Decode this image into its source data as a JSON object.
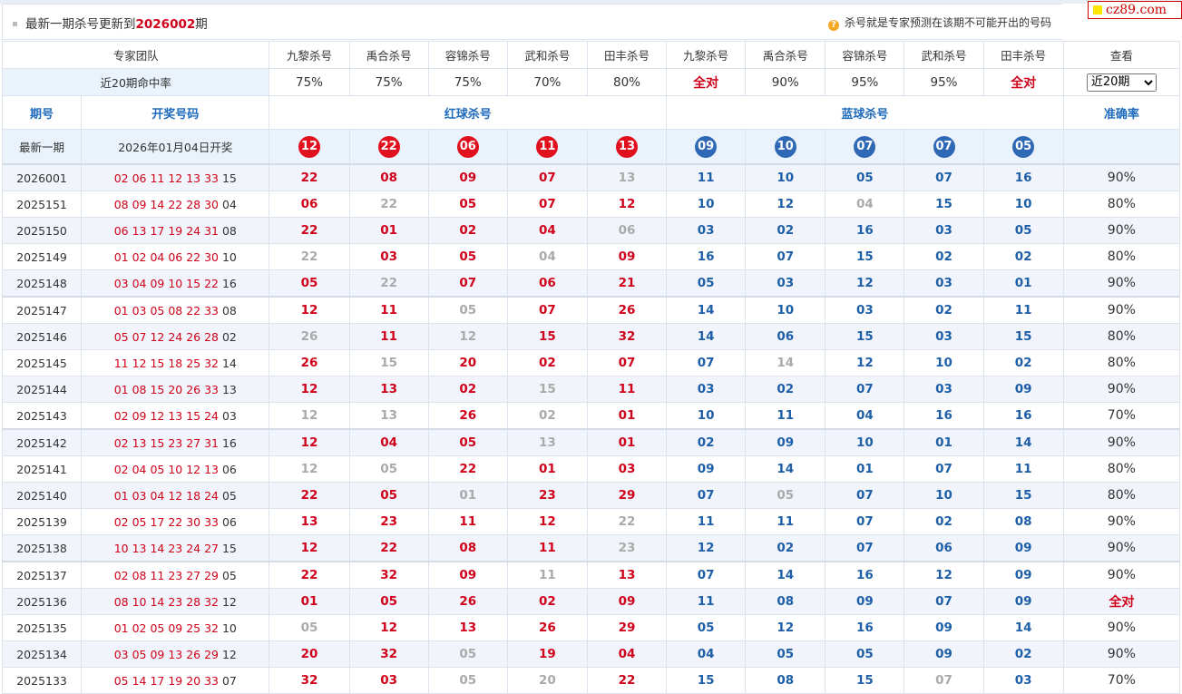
{
  "header": {
    "title_prefix": "最新一期杀号更新到",
    "title_period": "2026002",
    "title_suffix": "期",
    "tip": "杀号就是专家预测在该期不可能开出的号码",
    "logo": "cz89.com"
  },
  "table": {
    "team_label": "专家团队",
    "view_label": "查看",
    "experts": [
      "九黎杀号",
      "禹合杀号",
      "容锦杀号",
      "武和杀号",
      "田丰杀号",
      "九黎杀号",
      "禹合杀号",
      "容锦杀号",
      "武和杀号",
      "田丰杀号"
    ],
    "hit_label": "近20期命中率",
    "hit_rates": [
      "75%",
      "75%",
      "75%",
      "70%",
      "80%",
      "全对",
      "90%",
      "95%",
      "95%",
      "全对"
    ],
    "view_select": "近20期",
    "col_period": "期号",
    "col_numbers": "开奖号码",
    "col_red": "红球杀号",
    "col_blue": "蓝球杀号",
    "col_acc": "准确率",
    "latest_label": "最新一期",
    "latest_date": "2026年01月04日开奖",
    "latest_red": [
      "12",
      "22",
      "06",
      "11",
      "13"
    ],
    "latest_blue": [
      "09",
      "10",
      "07",
      "07",
      "05"
    ]
  },
  "rows": [
    {
      "p": "2026001",
      "r": "02 06 11 12 13 33",
      "b": "15",
      "k": [
        "22",
        "08",
        "09",
        "07",
        "13",
        "11",
        "10",
        "05",
        "07",
        "16"
      ],
      "a": "90%"
    },
    {
      "p": "2025151",
      "r": "08 09 14 22 28 30",
      "b": "04",
      "k": [
        "06",
        "22",
        "05",
        "07",
        "12",
        "10",
        "12",
        "04",
        "15",
        "10"
      ],
      "a": "80%"
    },
    {
      "p": "2025150",
      "r": "06 13 17 19 24 31",
      "b": "08",
      "k": [
        "22",
        "01",
        "02",
        "04",
        "06",
        "03",
        "02",
        "16",
        "03",
        "05"
      ],
      "a": "90%"
    },
    {
      "p": "2025149",
      "r": "01 02 04 06 22 30",
      "b": "10",
      "k": [
        "22",
        "03",
        "05",
        "04",
        "09",
        "16",
        "07",
        "15",
        "02",
        "02"
      ],
      "a": "80%"
    },
    {
      "p": "2025148",
      "r": "03 04 09 10 15 22",
      "b": "16",
      "k": [
        "05",
        "22",
        "07",
        "06",
        "21",
        "05",
        "03",
        "12",
        "03",
        "01"
      ],
      "a": "90%"
    },
    {
      "p": "2025147",
      "r": "01 03 05 08 22 33",
      "b": "08",
      "k": [
        "12",
        "11",
        "05",
        "07",
        "26",
        "14",
        "10",
        "03",
        "02",
        "11"
      ],
      "a": "90%"
    },
    {
      "p": "2025146",
      "r": "05 07 12 24 26 28",
      "b": "02",
      "k": [
        "26",
        "11",
        "12",
        "15",
        "32",
        "14",
        "06",
        "15",
        "03",
        "15"
      ],
      "a": "80%"
    },
    {
      "p": "2025145",
      "r": "11 12 15 18 25 32",
      "b": "14",
      "k": [
        "26",
        "15",
        "20",
        "02",
        "07",
        "07",
        "14",
        "12",
        "10",
        "02"
      ],
      "a": "80%"
    },
    {
      "p": "2025144",
      "r": "01 08 15 20 26 33",
      "b": "13",
      "k": [
        "12",
        "13",
        "02",
        "15",
        "11",
        "03",
        "02",
        "07",
        "03",
        "09"
      ],
      "a": "90%"
    },
    {
      "p": "2025143",
      "r": "02 09 12 13 15 24",
      "b": "03",
      "k": [
        "12",
        "13",
        "26",
        "02",
        "01",
        "10",
        "11",
        "04",
        "16",
        "16"
      ],
      "a": "70%"
    },
    {
      "p": "2025142",
      "r": "02 13 15 23 27 31",
      "b": "16",
      "k": [
        "12",
        "04",
        "05",
        "13",
        "01",
        "02",
        "09",
        "10",
        "01",
        "14"
      ],
      "a": "90%"
    },
    {
      "p": "2025141",
      "r": "02 04 05 10 12 13",
      "b": "06",
      "k": [
        "12",
        "05",
        "22",
        "01",
        "03",
        "09",
        "14",
        "01",
        "07",
        "11"
      ],
      "a": "80%"
    },
    {
      "p": "2025140",
      "r": "01 03 04 12 18 24",
      "b": "05",
      "k": [
        "22",
        "05",
        "01",
        "23",
        "29",
        "07",
        "05",
        "07",
        "10",
        "15"
      ],
      "a": "80%"
    },
    {
      "p": "2025139",
      "r": "02 05 17 22 30 33",
      "b": "06",
      "k": [
        "13",
        "23",
        "11",
        "12",
        "22",
        "11",
        "11",
        "07",
        "02",
        "08"
      ],
      "a": "90%"
    },
    {
      "p": "2025138",
      "r": "10 13 14 23 24 27",
      "b": "15",
      "k": [
        "12",
        "22",
        "08",
        "11",
        "23",
        "12",
        "02",
        "07",
        "06",
        "09"
      ],
      "a": "90%"
    },
    {
      "p": "2025137",
      "r": "02 08 11 23 27 29",
      "b": "05",
      "k": [
        "22",
        "32",
        "09",
        "11",
        "13",
        "07",
        "14",
        "16",
        "12",
        "09"
      ],
      "a": "90%"
    },
    {
      "p": "2025136",
      "r": "08 10 14 23 28 32",
      "b": "12",
      "k": [
        "01",
        "05",
        "26",
        "02",
        "09",
        "11",
        "08",
        "09",
        "07",
        "09"
      ],
      "a": "全对"
    },
    {
      "p": "2025135",
      "r": "01 02 05 09 25 32",
      "b": "10",
      "k": [
        "05",
        "12",
        "13",
        "26",
        "29",
        "05",
        "12",
        "16",
        "09",
        "14"
      ],
      "a": "90%"
    },
    {
      "p": "2025134",
      "r": "03 05 09 13 26 29",
      "b": "12",
      "k": [
        "20",
        "32",
        "05",
        "19",
        "04",
        "04",
        "05",
        "05",
        "09",
        "02"
      ],
      "a": "90%"
    },
    {
      "p": "2025133",
      "r": "05 14 17 19 20 33",
      "b": "07",
      "k": [
        "32",
        "03",
        "05",
        "20",
        "22",
        "15",
        "08",
        "15",
        "07",
        "03"
      ],
      "a": "70%"
    }
  ],
  "colors": {
    "red": "#d0021b",
    "blue": "#1e5fa8",
    "miss": "#aaaaaa",
    "header_blue": "#1e6bbd",
    "row_alt": "#f1f5fb"
  }
}
